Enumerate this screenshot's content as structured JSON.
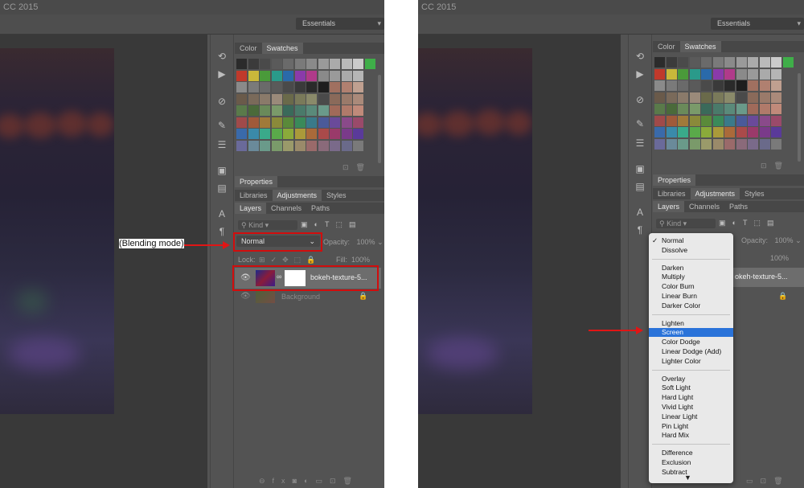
{
  "left": {
    "app_title": "CC 2015",
    "workspace": "Essentials",
    "panels": {
      "color_tab": "Color",
      "swatches_tab": "Swatches",
      "properties_title": "Properties",
      "tabs_row2": [
        "Libraries",
        "Adjustments",
        "Styles"
      ],
      "tabs_row3": [
        "Layers",
        "Channels",
        "Paths"
      ],
      "kind_filter": "Kind",
      "blend_mode": "Normal",
      "opacity_label": "Opacity:",
      "opacity_value": "100%",
      "lock_label": "Lock:",
      "fill_label": "Fill:",
      "fill_value": "100%",
      "layers": [
        {
          "name": "bokeh-texture-5...",
          "selected": true
        },
        {
          "name": "Background",
          "selected": false
        }
      ]
    },
    "annotation": "(Blending mode)"
  },
  "right": {
    "app_title": "CC 2015",
    "workspace": "Essentials",
    "panels": {
      "color_tab": "Color",
      "swatches_tab": "Swatches",
      "properties_title": "Properties",
      "tabs_row2": [
        "Libraries",
        "Adjustments",
        "Styles"
      ],
      "tabs_row3": [
        "Layers",
        "Channels",
        "Paths"
      ],
      "kind_filter": "Kind",
      "opacity_label": "Opacity:",
      "opacity_value": "100%",
      "fill_value": "100%",
      "layer_partial": "okeh-texture-5..."
    },
    "blend_menu": {
      "groups": [
        [
          "Normal",
          "Dissolve"
        ],
        [
          "Darken",
          "Multiply",
          "Color Burn",
          "Linear Burn",
          "Darker Color"
        ],
        [
          "Lighten",
          "Screen",
          "Color Dodge",
          "Linear Dodge (Add)",
          "Lighter Color"
        ],
        [
          "Overlay",
          "Soft Light",
          "Hard Light",
          "Vivid Light",
          "Linear Light",
          "Pin Light",
          "Hard Mix"
        ],
        [
          "Difference",
          "Exclusion",
          "Subtract"
        ]
      ],
      "checked": "Normal",
      "highlighted": "Screen",
      "scroll_indicator": "▼"
    }
  },
  "colors": {
    "ui_bg": "#535353",
    "annotation_red": "#d10d0d",
    "menu_highlight": "#2a73d9"
  },
  "swatches": [
    [
      "#2b2b2b",
      "#3b3b3b",
      "#4a4a4a",
      "#5a5a5a",
      "#6a6a6a",
      "#7a7a7a",
      "#8a8a8a",
      "#9a9a9a",
      "#aaaaaa",
      "#bababa",
      "#cacaca",
      "#3fae49"
    ],
    [
      "#c0392b",
      "#c9b83a",
      "#4a9a3a",
      "#2a9a8a",
      "#2a6aaa",
      "#8a3aaa",
      "#b03a8a",
      "#8a8a8a",
      "#9a9a9a",
      "#aaaaaa",
      "#b5b5b5"
    ],
    [
      "#8a8a8a",
      "#7a7a7a",
      "#6a6a6a",
      "#5a5a5a",
      "#4a4a4a",
      "#3a3a3a",
      "#2a2a2a",
      "#1e1e1e",
      "#a07060",
      "#b08070",
      "#c0a090"
    ],
    [
      "#6a5a4a",
      "#7a6a5a",
      "#8a7a6a",
      "#9a8a7a",
      "#6a6a4a",
      "#7a7a5a",
      "#8a8a6a",
      "#4a4a4a",
      "#8a6a5a",
      "#9a7a6a",
      "#aa8a7a"
    ],
    [
      "#5a7a4a",
      "#4a6a3a",
      "#6a8a5a",
      "#7a9a6a",
      "#3a6a5a",
      "#4a7a6a",
      "#5a8a7a",
      "#6a9a8a",
      "#a06a5a",
      "#b07a6a",
      "#c08a7a"
    ],
    [
      "#a04a4a",
      "#a05a3a",
      "#a07a3a",
      "#8a8a3a",
      "#5a8a3a",
      "#3a8a5a",
      "#3a7a8a",
      "#4a5a9a",
      "#6a4a9a",
      "#8a4a8a",
      "#9a4a6a"
    ],
    [
      "#3a6aaa",
      "#3a8aaa",
      "#3aaa8a",
      "#5aaa4a",
      "#8aaa3a",
      "#aa9a3a",
      "#aa6a3a",
      "#aa4a4a",
      "#9a3a6a",
      "#7a3a8a",
      "#5a3a9a"
    ],
    [
      "#6a6a9a",
      "#6a8a9a",
      "#6a9a8a",
      "#7a9a6a",
      "#9a9a6a",
      "#9a8a6a",
      "#9a6a6a",
      "#8a6a7a",
      "#7a6a8a",
      "#6a6a8a",
      "#7a7a7a"
    ]
  ]
}
